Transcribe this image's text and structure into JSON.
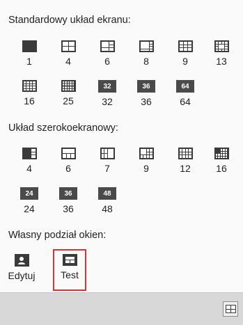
{
  "standard": {
    "title": "Standardowy układ ekranu:",
    "items": [
      "1",
      "4",
      "6",
      "8",
      "9",
      "13",
      "16",
      "25",
      "32",
      "36",
      "64"
    ],
    "badges": {
      "32": "32",
      "36": "36",
      "64": "64"
    }
  },
  "wide": {
    "title": "Układ szerokoekranowy:",
    "items": [
      "4",
      "6",
      "7",
      "9",
      "12",
      "16",
      "24",
      "36",
      "48"
    ],
    "badges": {
      "24": "24",
      "36": "36",
      "48": "48"
    }
  },
  "custom": {
    "title": "Własny podział okien:",
    "edit_label": "Edytuj",
    "test_label": "Test"
  },
  "icons": {
    "edit": "user-icon",
    "test": "layout-icon",
    "corner": "layout-4-icon"
  },
  "colors": {
    "icon": "#3a3a3a",
    "highlight": "#e23030",
    "footer": "#d8d8d8"
  }
}
